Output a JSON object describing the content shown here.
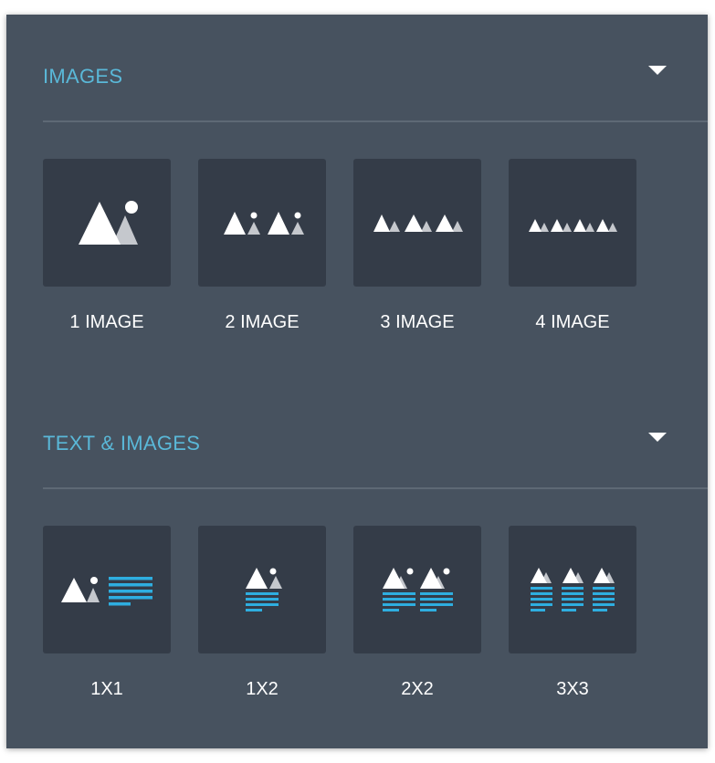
{
  "sections": [
    {
      "title": "IMAGES",
      "items": [
        {
          "label": "1 IMAGE",
          "icon": "single-image-layout-icon"
        },
        {
          "label": "2 IMAGE",
          "icon": "two-image-layout-icon"
        },
        {
          "label": "3 IMAGE",
          "icon": "three-image-layout-icon"
        },
        {
          "label": "4 IMAGE",
          "icon": "four-image-layout-icon"
        }
      ]
    },
    {
      "title": "TEXT & IMAGES",
      "items": [
        {
          "label": "1X1",
          "icon": "image-beside-text-layout-icon"
        },
        {
          "label": "1X2",
          "icon": "image-above-text-layout-icon"
        },
        {
          "label": "2X2",
          "icon": "two-column-text-image-layout-icon"
        },
        {
          "label": "3X3",
          "icon": "three-column-text-image-layout-icon"
        }
      ]
    }
  ],
  "colors": {
    "panel": "#47525f",
    "tile": "#343c48",
    "section_title": "#5ab8d8",
    "text_lines": "#2eaee0",
    "mountain_front": "#ffffff",
    "mountain_back": "#c5c8cd"
  }
}
